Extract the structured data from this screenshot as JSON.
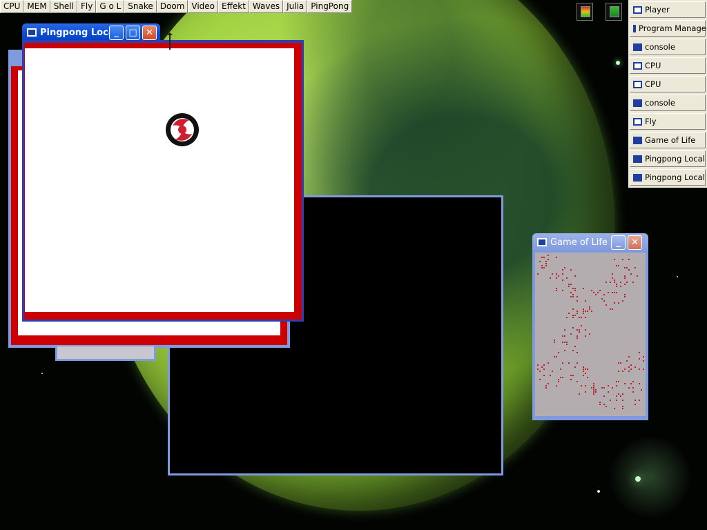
{
  "launcher": [
    "CPU",
    "MEM",
    "Shell",
    "Fly",
    "G o L",
    "Snake",
    "Doom",
    "Video",
    "Effekt",
    "Waves",
    "Julia",
    "PingPong"
  ],
  "tasklist": [
    {
      "label": "Player",
      "icon": "window-icon"
    },
    {
      "label": "Program Manager",
      "icon": "window-icon"
    },
    {
      "label": "console",
      "icon": "console-icon"
    },
    {
      "label": "CPU",
      "icon": "window-icon"
    },
    {
      "label": "CPU",
      "icon": "window-icon"
    },
    {
      "label": "console",
      "icon": "console-icon"
    },
    {
      "label": "Fly",
      "icon": "window-icon"
    },
    {
      "label": "Game of Life",
      "icon": "console-icon"
    },
    {
      "label": "Pingpong Local",
      "icon": "console-icon"
    },
    {
      "label": "Pingpong Local",
      "icon": "console-icon"
    }
  ],
  "windows": {
    "pingpong": {
      "title": "Pingpong Local"
    },
    "gol": {
      "title": "Game of Life"
    }
  },
  "colors": {
    "pingpong_border": "#cc0000",
    "pingpong_frame": "#2f3fb0",
    "gol_bg": "#b3adb0",
    "gol_cell": "#c0202c"
  }
}
